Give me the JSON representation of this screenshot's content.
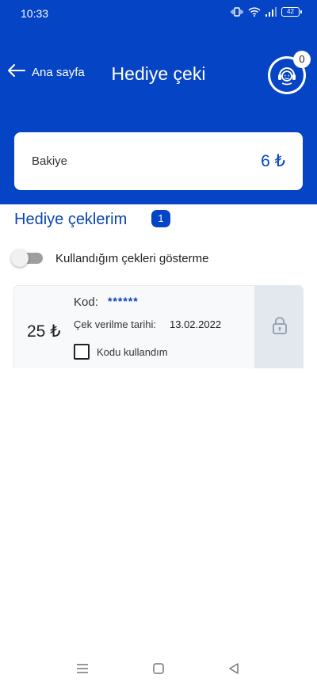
{
  "status_bar": {
    "time": "10:33",
    "battery": "42"
  },
  "header": {
    "back_label": "Ana sayfa",
    "title": "Hediye çeki",
    "support_badge": "0",
    "background_color": "#0544c4"
  },
  "balance": {
    "label": "Bakiye",
    "value": "6 ₺"
  },
  "vouchers_section": {
    "title": "Hediye çeklerim",
    "count": "1",
    "toggle_label": "Kullandığım çekleri gösterme",
    "toggle_on": false
  },
  "vouchers": [
    {
      "amount": "25 ₺",
      "code_label": "Kod:",
      "code_value": "******",
      "date_label": "Çek verilme tarihi:",
      "date_value": "13.02.2022",
      "used_label": "Kodu kullandım",
      "used_checked": false,
      "icon": "lock-icon"
    }
  ],
  "nav_bar": {
    "icons": [
      "menu-icon",
      "home-square-icon",
      "back-triangle-icon"
    ]
  }
}
